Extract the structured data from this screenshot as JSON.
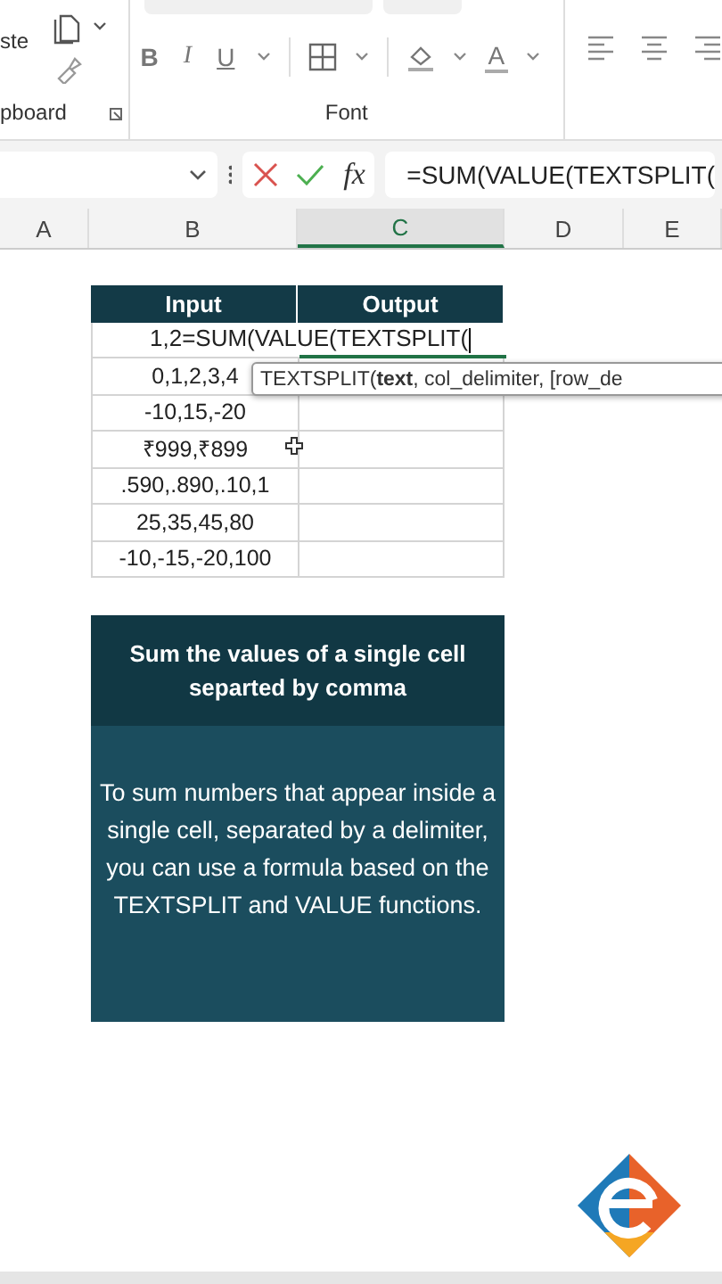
{
  "ribbon": {
    "paste_label": "ste",
    "groups": [
      {
        "label": "pboard"
      },
      {
        "label": "Font"
      }
    ],
    "format_buttons": [
      "B",
      "I",
      "U"
    ],
    "font_color": "A"
  },
  "formula_bar": {
    "fx": "fx",
    "formula": "=SUM(VALUE(TEXTSPLIT("
  },
  "columns": [
    {
      "label": "A",
      "selected": false
    },
    {
      "label": "B",
      "selected": false
    },
    {
      "label": "C",
      "selected": true
    },
    {
      "label": "D",
      "selected": false
    },
    {
      "label": "E",
      "selected": false
    }
  ],
  "table": {
    "headers": [
      "Input",
      "Output"
    ],
    "rows": [
      {
        "input": "1,2=SUM(VALUE(TEXTSPLIT(",
        "editing": true
      },
      {
        "input": "0,1,2,3,4",
        "editing": false
      },
      {
        "input": "-10,15,-20",
        "editing": false
      },
      {
        "input": "₹999,₹899",
        "editing": false
      },
      {
        "input": ".590,.890,.10,1",
        "editing": false
      },
      {
        "input": "25,35,45,80",
        "editing": false
      },
      {
        "input": "-10,-15,-20,100",
        "editing": false
      }
    ]
  },
  "tooltip": {
    "text": "TEXTSPLIT(**text**, col_delimiter, [row_de"
  },
  "card": {
    "title": "Sum the values of a single cell separted by comma",
    "body": "To sum numbers that appear inside a single cell, separated by a delimiter, you can use a formula based on the TEXTSPLIT and VALUE functions."
  }
}
